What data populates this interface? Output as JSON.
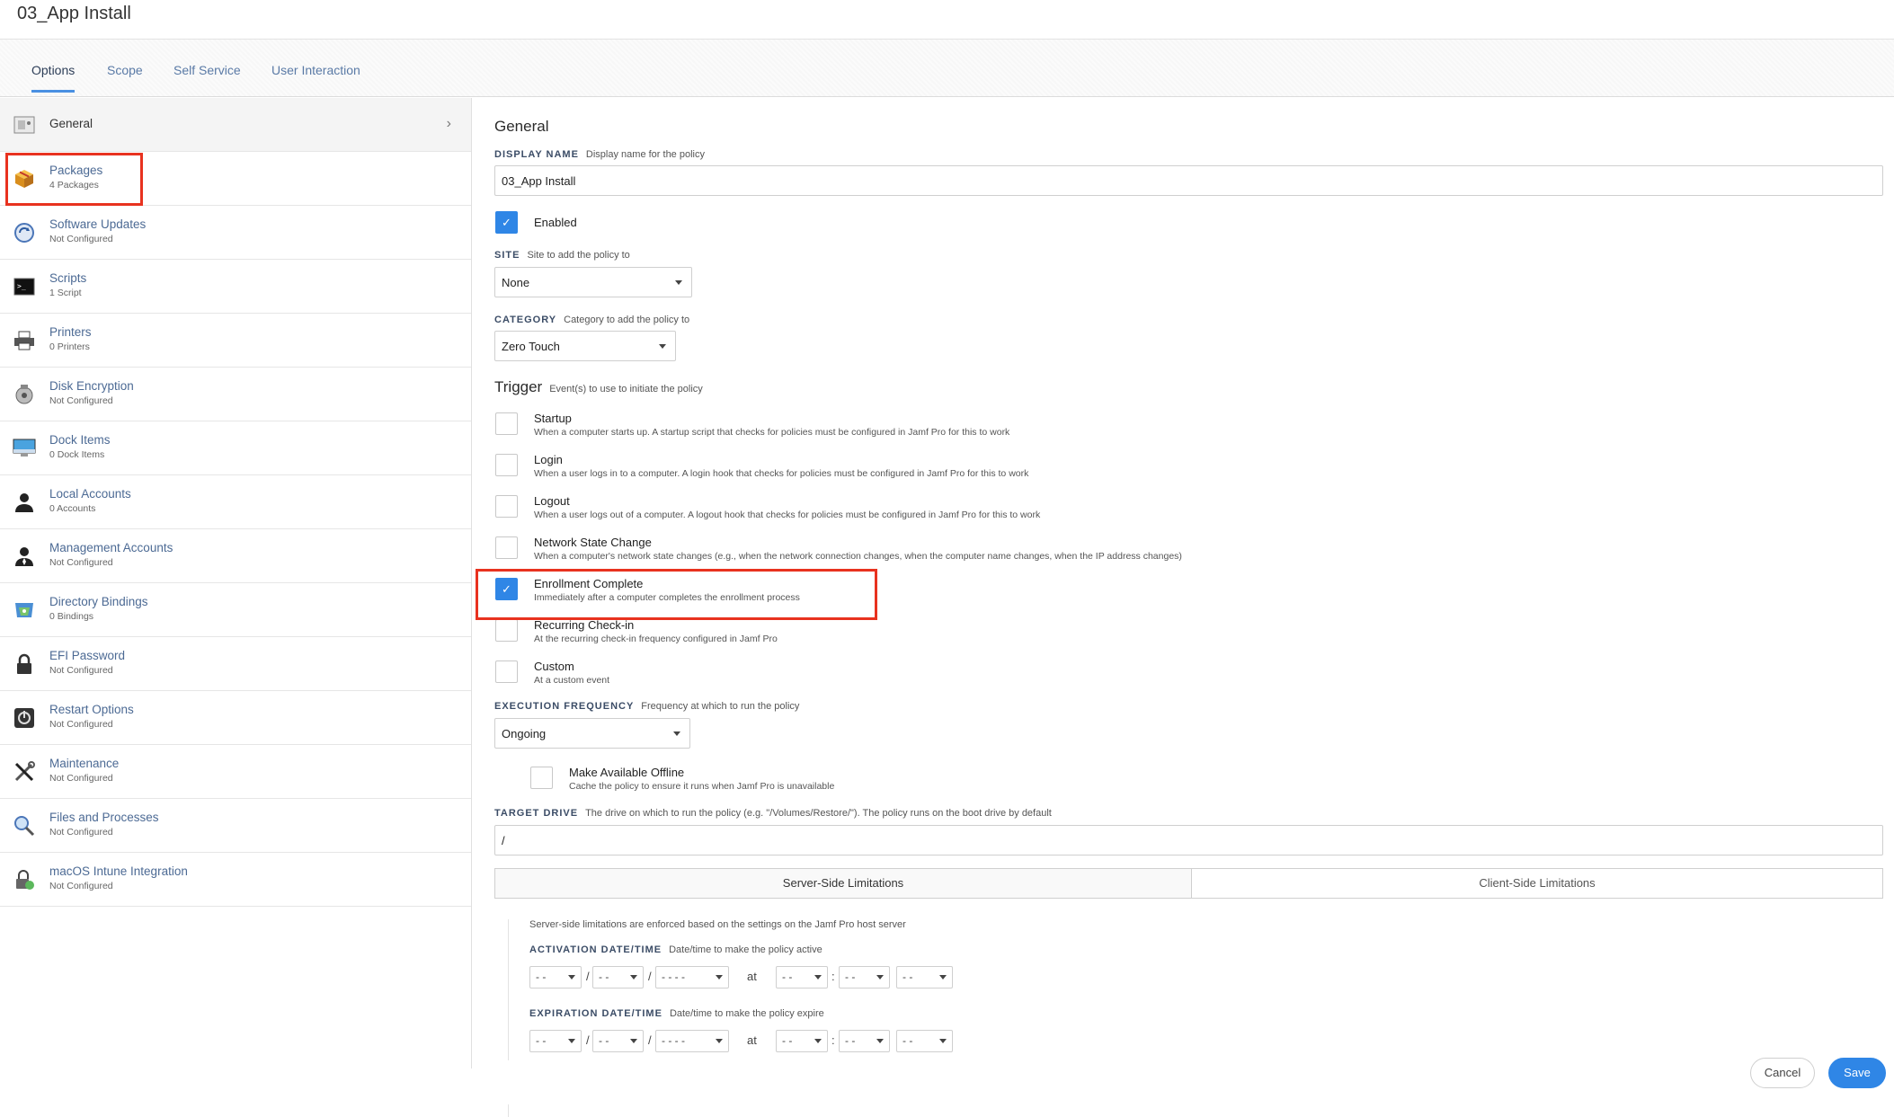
{
  "window": {
    "title": "03_App Install"
  },
  "tabs": [
    {
      "label": "Options",
      "active": true
    },
    {
      "label": "Scope"
    },
    {
      "label": "Self Service"
    },
    {
      "label": "User Interaction"
    }
  ],
  "sidebar": {
    "items": [
      {
        "label": "General",
        "sub": "",
        "icon": "general-icon"
      },
      {
        "label": "Packages",
        "sub": "4 Packages",
        "icon": "package-icon"
      },
      {
        "label": "Software Updates",
        "sub": "Not Configured",
        "icon": "software-update-icon"
      },
      {
        "label": "Scripts",
        "sub": "1 Script",
        "icon": "terminal-icon"
      },
      {
        "label": "Printers",
        "sub": "0 Printers",
        "icon": "printer-icon"
      },
      {
        "label": "Disk Encryption",
        "sub": "Not Configured",
        "icon": "disk-encryption-icon"
      },
      {
        "label": "Dock Items",
        "sub": "0 Dock Items",
        "icon": "dock-icon"
      },
      {
        "label": "Local Accounts",
        "sub": "0 Accounts",
        "icon": "user-icon"
      },
      {
        "label": "Management Accounts",
        "sub": "Not Configured",
        "icon": "admin-user-icon"
      },
      {
        "label": "Directory Bindings",
        "sub": "0 Bindings",
        "icon": "directory-icon"
      },
      {
        "label": "EFI Password",
        "sub": "Not Configured",
        "icon": "lock-icon"
      },
      {
        "label": "Restart Options",
        "sub": "Not Configured",
        "icon": "restart-icon"
      },
      {
        "label": "Maintenance",
        "sub": "Not Configured",
        "icon": "tools-icon"
      },
      {
        "label": "Files and Processes",
        "sub": "Not Configured",
        "icon": "magnifier-icon"
      },
      {
        "label": "macOS Intune Integration",
        "sub": "Not Configured",
        "icon": "intune-icon"
      }
    ]
  },
  "general": {
    "heading": "General",
    "display_name": {
      "label": "DISPLAY NAME",
      "hint": "Display name for the policy",
      "value": "03_App Install"
    },
    "enabled_label": "Enabled",
    "site": {
      "label": "SITE",
      "hint": "Site to add the policy to",
      "value": "None"
    },
    "category": {
      "label": "CATEGORY",
      "hint": "Category to add the policy to",
      "value": "Zero Touch"
    }
  },
  "trigger": {
    "heading": "Trigger",
    "hint": "Event(s) to use to initiate the policy",
    "items": [
      {
        "label": "Startup",
        "desc": "When a computer starts up. A startup script that checks for policies must be configured in Jamf Pro for this to work",
        "checked": false
      },
      {
        "label": "Login",
        "desc": "When a user logs in to a computer. A login hook that checks for policies must be configured in Jamf Pro for this to work",
        "checked": false
      },
      {
        "label": "Logout",
        "desc": "When a user logs out of a computer. A logout hook that checks for policies must be configured in Jamf Pro for this to work",
        "checked": false
      },
      {
        "label": "Network State Change",
        "desc": "When a computer's network state changes (e.g., when the network connection changes, when the computer name changes, when the IP address changes)",
        "checked": false
      },
      {
        "label": "Enrollment Complete",
        "desc": "Immediately after a computer completes the enrollment process",
        "checked": true
      },
      {
        "label": "Recurring Check-in",
        "desc": "At the recurring check-in frequency configured in Jamf Pro",
        "checked": false
      },
      {
        "label": "Custom",
        "desc": "At a custom event",
        "checked": false
      }
    ]
  },
  "execution": {
    "label": "EXECUTION FREQUENCY",
    "hint": "Frequency at which to run the policy",
    "value": "Ongoing"
  },
  "offline": {
    "label": "Make Available Offline",
    "desc": "Cache the policy to ensure it runs when Jamf Pro is unavailable"
  },
  "target_drive": {
    "label": "TARGET DRIVE",
    "hint": "The drive on which to run the policy (e.g. \"/Volumes/Restore/\"). The policy runs on the boot drive by default",
    "value": "/"
  },
  "limitations": {
    "tabs": [
      "Server-Side Limitations",
      "Client-Side Limitations"
    ],
    "note": "Server-side limitations are enforced based on the settings on the Jamf Pro host server",
    "activation": {
      "label": "ACTIVATION DATE/TIME",
      "hint": "Date/time to make the policy active"
    },
    "expiration": {
      "label": "EXPIRATION DATE/TIME",
      "hint": "Date/time to make the policy expire"
    },
    "placeholders": {
      "month": "- -",
      "day": "- -",
      "year": "- - - -",
      "hour": "- -",
      "minute": "- -",
      "ampm": "- -"
    },
    "sep_slash": "/",
    "sep_colon": ":",
    "at": "at"
  },
  "footer": {
    "cancel": "Cancel",
    "save": "Save"
  },
  "colors": {
    "accent": "#2f86e6",
    "highlight": "#e8321f",
    "link": "#4c6a94"
  }
}
